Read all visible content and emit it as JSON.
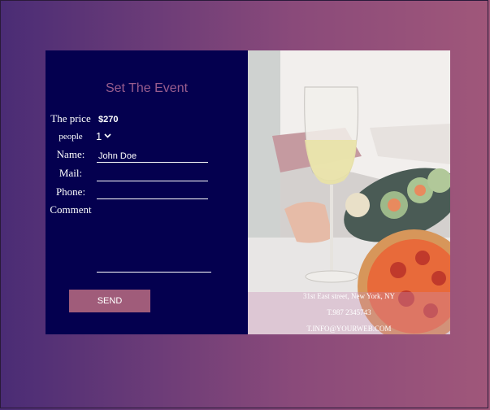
{
  "form": {
    "title": "Set The Event",
    "price_label": "The price",
    "price_value": "$270",
    "people_label": "people",
    "people_value": "1",
    "name_label": "Name:",
    "name_value": "John Doe",
    "mail_label": "Mail:",
    "phone_label": "Phone:",
    "comment_label": "Comment",
    "send_label": "SEND"
  },
  "footer": {
    "address": "31st East street, New York, NY",
    "phone": "T.987 2345743",
    "email": "T.INFO@YOURWEB.COM"
  },
  "colors": {
    "form_bg": "#04004f",
    "title": "#9a5d8e",
    "button": "#a05c7a"
  },
  "icons": [
    "chevron-down-icon"
  ]
}
